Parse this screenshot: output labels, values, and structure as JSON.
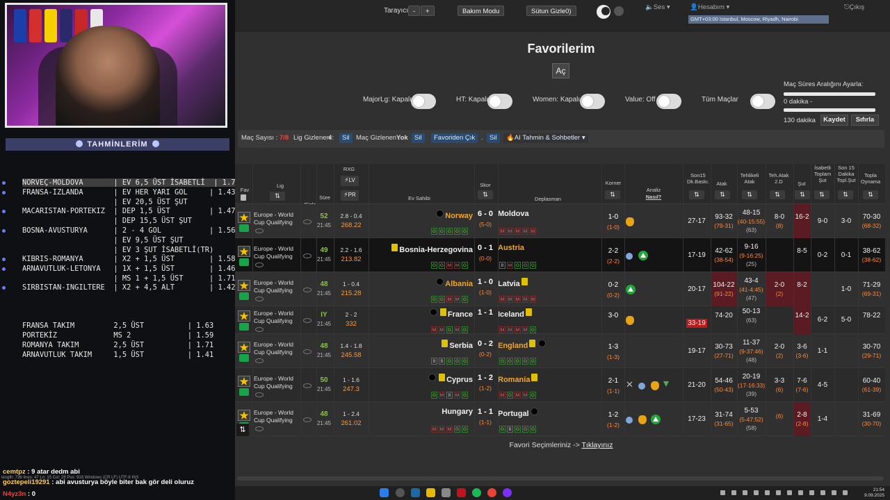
{
  "stream": {
    "tahmin_header": "TAHMİNLERİM",
    "tips": [
      "NORVEÇ-MOLDOVA       | EV 6,5 ÜST İSABETLİ  | 1.74",
      "FRANSA-IZLANDA       | EV HER YARI GOL     | 1.43",
      "                     | EV 20,5 ÜST ŞUT",
      "MACARISTAN-PORTEKIZ  | DEP 1,5 ÜST         | 1.47",
      "                     | DEP 15,5 ÜST ŞUT",
      "BOSNA-AVUSTURYA      | 2 - 4 GOL           | 1.56",
      "                     | EV 9,5 ÜST ŞUT",
      "                     | EV 3 ŞUT İSABETLİ(TR)",
      "KIBRIS-ROMANYA       | X2 + 1,5 ÜST        | 1.58",
      "ARNAVUTLUK-LETONYA   | 1X + 1,5 ÜST        | 1.46",
      "                     | MS 1 + 1,5 ÜST      | 1.71",
      "SIRBISTAN-INGILTERE  | X2 + 4,5 ALT        | 1.42"
    ],
    "tips2": [
      "FRANSA TAKIM         2,5 ÜST          | 1.63",
      "PORTEKİZ             MS 2             | 1.59",
      "ROMANYA TAKIM        2,5 ÜST          | 1.71",
      "ARNAVUTLUK TAKIM     1,5 ÜST          | 1.41"
    ],
    "chat": [
      {
        "user": "cemtpz",
        "text": " : 9 atar dedm abi"
      },
      {
        "user": "goztepeli19291",
        "text": " : abi avusturya böyle biter bak gör deli oluruz"
      },
      {
        "user": "N4yz3n",
        "text": " : 0"
      }
    ],
    "status_bar": "length: 736   lines: 47      Ln: 15  Col: 28  Pos: 918                    Windows (CR LF)    UTF-8                    INS"
  },
  "topbar": {
    "tarayici_label": "Tarayıcı",
    "minus": "-",
    "plus": "+",
    "bakim": "Bakım Modu",
    "sutun": "Sütun Gizle0)",
    "ses": "Ses",
    "hesabim": "Hesabım",
    "cikis": "Çıkış",
    "timezone": "GMT+03:00 Istanbul, Moscow, Riyadh, Nairobi"
  },
  "page": {
    "title": "Favorilerim",
    "ac": "Aç",
    "switches": [
      {
        "label": "MajorLg: Kapalı"
      },
      {
        "label": "HT: Kapalı"
      },
      {
        "label": "Women: Kapalı"
      },
      {
        "label": "Value: Off"
      },
      {
        "label": "Tüm Maçlar"
      }
    ],
    "range_title": "Maç Süres Aralığını Ayarla:",
    "range_min": "0 dakika -",
    "range_max": "130 dakika",
    "kaydet": "Kaydet",
    "sifirla": "Sıfırla"
  },
  "filters": {
    "mac_sayisi": "Maç Sayısı :",
    "mac_sayisi_val": "7/8",
    "lig_gizlenen": "Lig Gizlenen :",
    "lig_gizlenen_val": "4",
    "sil": "Sil",
    "mac_gizlenen": "Maç Gizlenen :",
    "mac_gizlenen_val": "Yok",
    "favoriden_cik": "Favoriden Çık",
    "dot": ".",
    "ai": "AI Tahmin & Sohbetler"
  },
  "headers": {
    "fav": "Fav",
    "lig": "Lig",
    "gizle": "Gizle",
    "sure": "Süre",
    "rxg": "RXG",
    "lv": "LV",
    "pr": "PR",
    "ev": "Ev Sahibi",
    "skor": "Skor",
    "dep": "Deplasman",
    "korner": "Korner",
    "analiz": "Analiz",
    "nasil": "Nasıl?",
    "son15": "Son15 Dk.Baskı.",
    "atak": "Atak",
    "tehlikeli": "Tehlikeli Atak",
    "tehatak": "Teh.Atak 2.D",
    "sut": "Şut",
    "isabetli": "İsabetli Toplam Şut",
    "son15sut": "Son 15 Dakika Topl.Şut",
    "topla": "Topla Oynama",
    "sort": "⇅"
  },
  "matches": [
    {
      "league": "Europe - World Cup Qualifying",
      "min": "52",
      "time": "21:45",
      "rxg": "2.8 - 0.4",
      "rxg2": "268.22",
      "home": "Norway",
      "away": "Moldova",
      "score": "6 - 0",
      "ht": "(5-0)",
      "home_form": "GGGGG",
      "away_form": "MMMMM",
      "korner": "1-0",
      "korner_ht": "(1-0)",
      "son15": "27-17",
      "atak": "93-32",
      "atak2": "(79-31)",
      "teh": "48-15",
      "teh2": "(40-15:55)",
      "teh3": "(63)",
      "teh2d": "8-0",
      "teh2d2": "(8)",
      "sut": "16-2",
      "isabet": "9-0",
      "son15sut": "3-0",
      "topla": "70-30",
      "topla2": "(68-32)"
    },
    {
      "league": "Europe - World Cup Qualifying",
      "min": "49",
      "time": "21:45",
      "rxg": "2.2 - 1.6",
      "rxg2": "213.82",
      "home": "Bosnia-Herzegovina",
      "away": "Austria",
      "score": "0 - 1",
      "ht": "(0-0)",
      "home_form": "GGMMG",
      "away_form": "BMGGG",
      "korner": "2-2",
      "korner_ht": "(2-2)",
      "son15": "17-19",
      "atak": "42-62",
      "atak2": "(38-54)",
      "teh": "9-16",
      "teh2": "(9-16:25)",
      "teh3": "(25)",
      "teh2d": "",
      "teh2d2": "",
      "sut": "8-5",
      "isabet": "0-2",
      "son15sut": "0-1",
      "topla": "38-62",
      "topla2": "(38-62)"
    },
    {
      "league": "Europe - World Cup Qualifying",
      "min": "48",
      "time": "21:45",
      "rxg": "1 - 0.4",
      "rxg2": "215.28",
      "home": "Albania",
      "away": "Latvia",
      "score": "1 - 0",
      "ht": "(1-0)",
      "home_form": "GGMMG",
      "away_form": "MMMMM",
      "korner": "0-2",
      "korner_ht": "(0-2)",
      "son15": "20-17",
      "atak": "104-22",
      "atak2": "(91-22)",
      "teh": "43-4",
      "teh2": "(41-4:45)",
      "teh3": "(47)",
      "teh2d": "2-0",
      "teh2d2": "(2)",
      "sut": "8-2",
      "isabet": "",
      "son15sut": "1-0",
      "topla": "71-29",
      "topla2": "(69-31)"
    },
    {
      "league": "Europe - World Cup Qualifying",
      "min": "IY",
      "time": "21:45",
      "rxg": "2 - 2",
      "rxg2": "332",
      "home": "France",
      "away": "Iceland",
      "score": "1 - 1",
      "ht": "",
      "home_form": "MMGMG",
      "away_form": "MMMMG",
      "korner": "3-0",
      "korner_ht": "",
      "son15": "33-19",
      "atak": "74-20",
      "atak2": "",
      "teh": "50-13",
      "teh2": "",
      "teh3": "(63)",
      "teh2d": "",
      "teh2d2": "",
      "sut": "14-2",
      "isabet": "6-2",
      "son15sut": "5-0",
      "topla": "78-22",
      "topla2": ""
    },
    {
      "league": "Europe - World Cup Qualifying",
      "min": "48",
      "time": "21:45",
      "rxg": "1.4 - 1.8",
      "rxg2": "245.58",
      "home": "Serbia",
      "away": "England",
      "score": "0 - 2",
      "ht": "(0-2)",
      "home_form": "BBGGG",
      "away_form": "GGGGG",
      "korner": "1-3",
      "korner_ht": "(1-3)",
      "son15": "19-17",
      "atak": "30-73",
      "atak2": "(27-71)",
      "teh": "11-37",
      "teh2": "(9-37:46)",
      "teh3": "(48)",
      "teh2d": "2-0",
      "teh2d2": "(2)",
      "sut": "3-6",
      "sut2": "(3-6)",
      "isabet": "1-1",
      "son15sut": "",
      "topla": "30-70",
      "topla2": "(29-71)"
    },
    {
      "league": "Europe - World Cup Qualifying",
      "min": "50",
      "time": "21:45",
      "rxg": "1 - 1.6",
      "rxg2": "247.3",
      "home": "Cyprus",
      "away": "Romania",
      "score": "1 - 2",
      "ht": "(1-2)",
      "home_form": "GMBMG",
      "away_form": "MGMMG",
      "korner": "2-1",
      "korner_ht": "(1-1)",
      "son15": "21-20",
      "atak": "54-46",
      "atak2": "(50-43)",
      "teh": "20-19",
      "teh2": "(17-16:33)",
      "teh3": "(39)",
      "teh2d": "3-3",
      "teh2d2": "(6)",
      "sut": "7-6",
      "sut2": "(7-6)",
      "isabet": "4-5",
      "son15sut": "",
      "topla": "60-40",
      "topla2": "(61-39)"
    },
    {
      "league": "Europe - World Cup Qualifying",
      "min": "48",
      "time": "21:45",
      "rxg": "1 - 2.4",
      "rxg2": "261.02",
      "home": "Hungary",
      "away": "Portugal",
      "score": "1 - 1",
      "ht": "(1-1)",
      "home_form": "MMMGG",
      "away_form": "GBGGG",
      "korner": "1-2",
      "korner_ht": "(1-2)",
      "son15": "17-23",
      "atak": "31-74",
      "atak2": "(31-65)",
      "teh": "5-53",
      "teh2": "(5-47:52)",
      "teh3": "(58)",
      "teh2d": "",
      "teh2d2": "(6)",
      "sut": "2-8",
      "sut2": "(2-8)",
      "isabet": "1-4",
      "son15sut": "",
      "topla": "31-69",
      "topla2": "(30-70)"
    }
  ],
  "footer": {
    "text": "Favori Seçimleriniz ->",
    "link": "Tıklayınız"
  },
  "taskbar": {
    "time": "21:54",
    "date": "9.09.2025"
  },
  "colors": {
    "accent_orange": "#f5a623",
    "red": "#b91c1c",
    "green": "#22a63b",
    "tz": "#5d6f8c"
  }
}
